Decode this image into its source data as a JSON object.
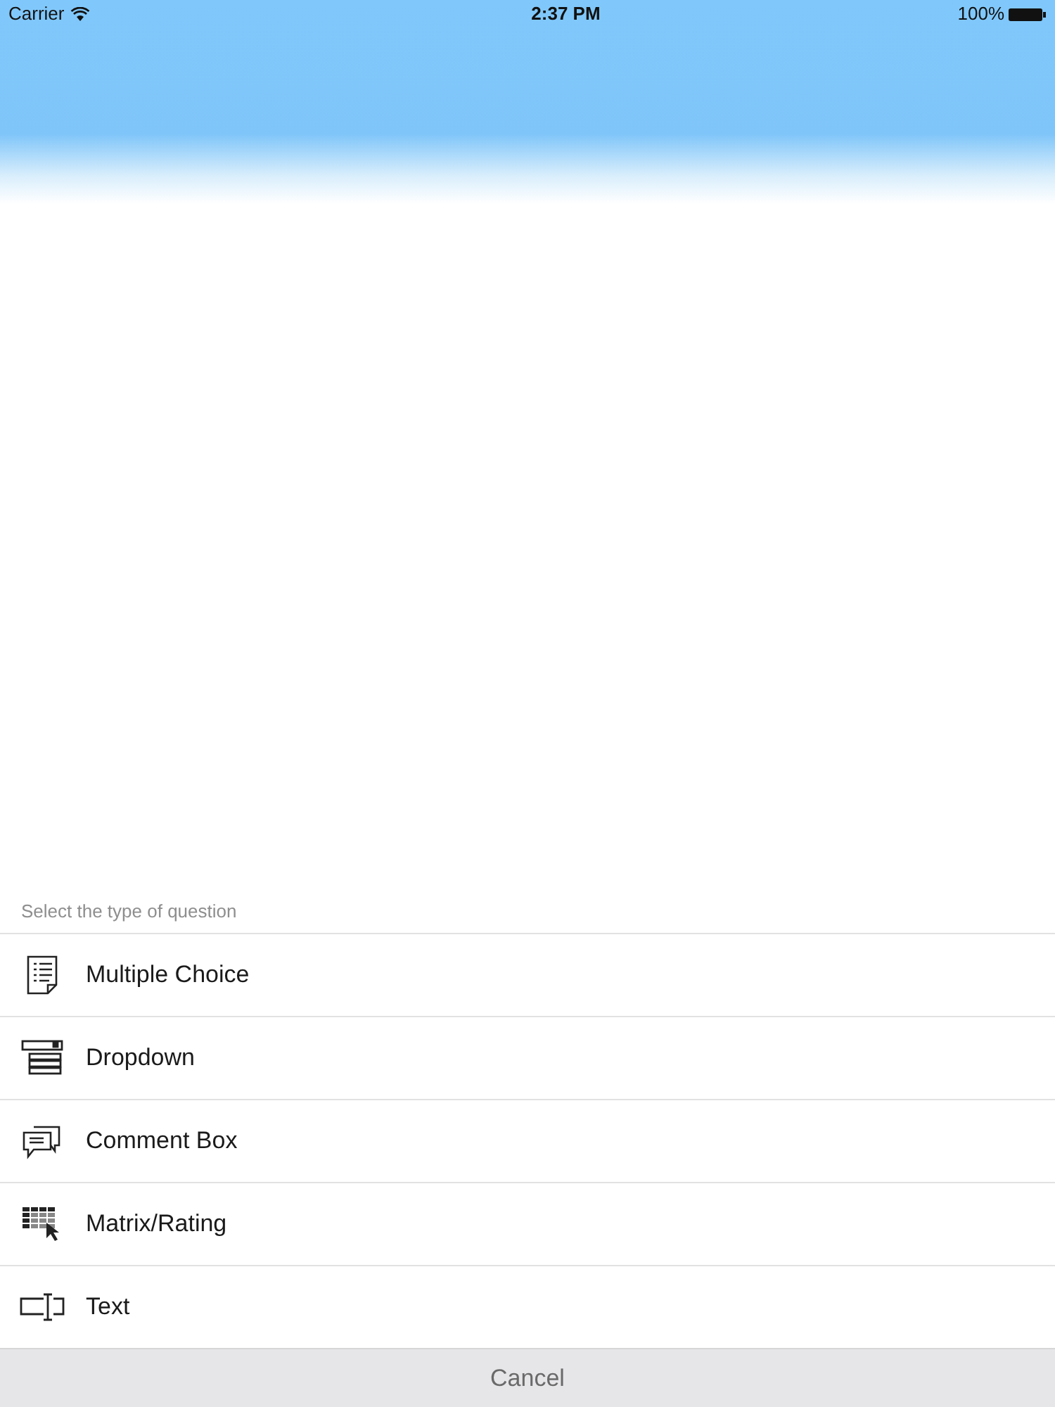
{
  "status_bar": {
    "carrier": "Carrier",
    "time": "2:37 PM",
    "battery": "100%"
  },
  "action_sheet": {
    "title": "Select the type of question",
    "options": [
      {
        "kind": "multiple",
        "label": "Multiple Choice"
      },
      {
        "kind": "dropdown",
        "label": "Dropdown"
      },
      {
        "kind": "comment",
        "label": "Comment Box"
      },
      {
        "kind": "matrix",
        "label": "Matrix/Rating"
      },
      {
        "kind": "text",
        "label": "Text"
      }
    ],
    "cancel": "Cancel"
  }
}
